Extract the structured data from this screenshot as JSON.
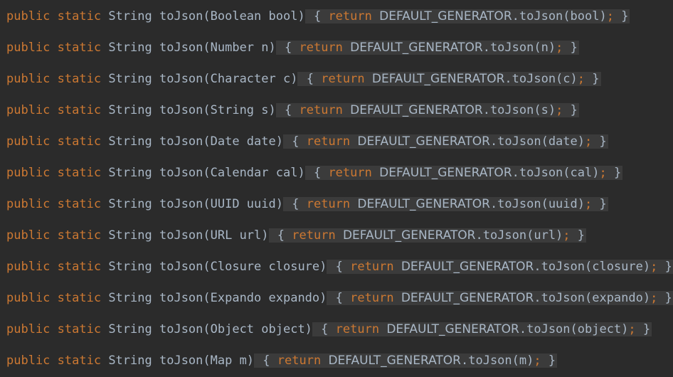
{
  "editor": {
    "lines": [
      {
        "mod": "public static",
        "type": "String",
        "sig": "toJson(Boolean bool)",
        "ret": "return",
        "call": "DEFAULT_GENERATOR",
        "call_rest": ".toJson(bool)",
        "semi": ";",
        "open": "{",
        "close": "}"
      },
      {
        "mod": "public static",
        "type": "String",
        "sig": "toJson(Number n)",
        "ret": "return",
        "call": "DEFAULT_GENERATOR",
        "call_rest": ".toJson(n)",
        "semi": ";",
        "open": "{",
        "close": "}"
      },
      {
        "mod": "public static",
        "type": "String",
        "sig": "toJson(Character c)",
        "ret": "return",
        "call": "DEFAULT_GENERATOR",
        "call_rest": ".toJson(c)",
        "semi": ";",
        "open": "{",
        "close": "}"
      },
      {
        "mod": "public static",
        "type": "String",
        "sig": "toJson(String s)",
        "ret": "return",
        "call": "DEFAULT_GENERATOR",
        "call_rest": ".toJson(s)",
        "semi": ";",
        "open": "{",
        "close": "}"
      },
      {
        "mod": "public static",
        "type": "String",
        "sig": "toJson(Date date)",
        "ret": "return",
        "call": "DEFAULT_GENERATOR",
        "call_rest": ".toJson(date)",
        "semi": ";",
        "open": "{",
        "close": "}"
      },
      {
        "mod": "public static",
        "type": "String",
        "sig": "toJson(Calendar cal)",
        "ret": "return",
        "call": "DEFAULT_GENERATOR",
        "call_rest": ".toJson(cal)",
        "semi": ";",
        "open": "{",
        "close": "}"
      },
      {
        "mod": "public static",
        "type": "String",
        "sig": "toJson(UUID uuid)",
        "ret": "return",
        "call": "DEFAULT_GENERATOR",
        "call_rest": ".toJson(uuid)",
        "semi": ";",
        "open": "{",
        "close": "}"
      },
      {
        "mod": "public static",
        "type": "String",
        "sig": "toJson(URL url)",
        "ret": "return",
        "call": "DEFAULT_GENERATOR",
        "call_rest": ".toJson(url)",
        "semi": ";",
        "open": "{",
        "close": "}"
      },
      {
        "mod": "public static",
        "type": "String",
        "sig": "toJson(Closure closure)",
        "ret": "return",
        "call": "DEFAULT_GENERATOR",
        "call_rest": ".toJson(closure)",
        "semi": ";",
        "open": "{",
        "close": "}"
      },
      {
        "mod": "public static",
        "type": "String",
        "sig": "toJson(Expando expando)",
        "ret": "return",
        "call": "DEFAULT_GENERATOR",
        "call_rest": ".toJson(expando)",
        "semi": ";",
        "open": "{",
        "close": "}"
      },
      {
        "mod": "public static",
        "type": "String",
        "sig": "toJson(Object object)",
        "ret": "return",
        "call": "DEFAULT_GENERATOR",
        "call_rest": ".toJson(object)",
        "semi": ";",
        "open": "{",
        "close": "}"
      },
      {
        "mod": "public static",
        "type": "String",
        "sig": "toJson(Map m)",
        "ret": "return",
        "call": "DEFAULT_GENERATOR",
        "call_rest": ".toJson(m)",
        "semi": ";",
        "open": "{",
        "close": "}"
      }
    ],
    "colors": {
      "background": "#2b2b2b",
      "keyword": "#cc7832",
      "text": "#a9b7c6",
      "fold_region": "#3b3b3b"
    }
  }
}
